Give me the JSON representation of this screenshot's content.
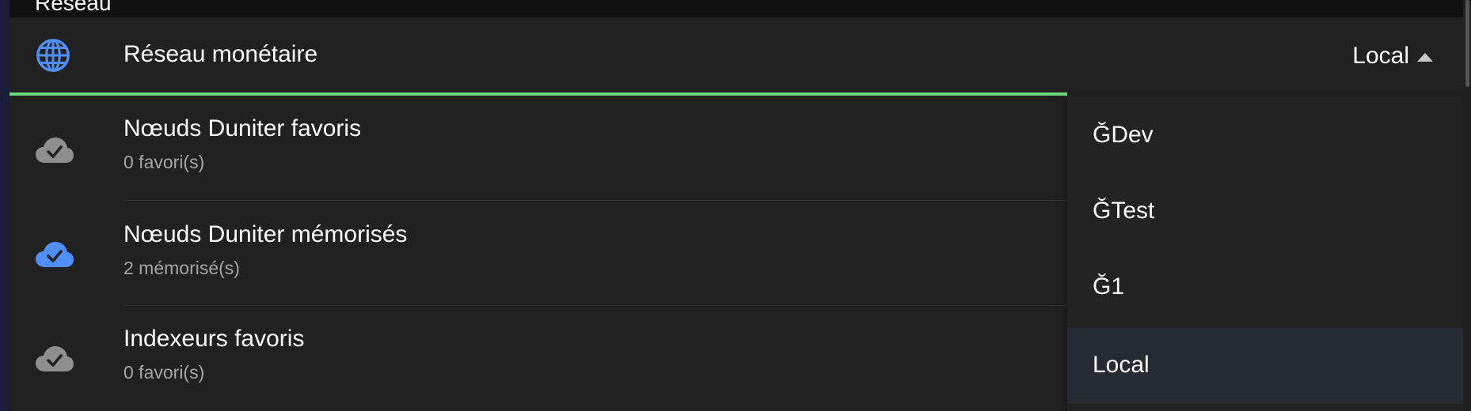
{
  "section": {
    "title": "Réseau"
  },
  "network": {
    "label": "Réseau monétaire",
    "selected": "Local",
    "icon": "globe-icon",
    "accent": "#6fd67c"
  },
  "items": [
    {
      "title": "Nœuds Duniter favoris",
      "subtitle": "0 favori(s)",
      "icon": "cloud-check-icon",
      "icon_color": "#8e8e8e"
    },
    {
      "title": "Nœuds Duniter mémorisés",
      "subtitle": "2 mémorisé(s)",
      "icon": "cloud-check-icon",
      "icon_color": "#4f8ff7"
    },
    {
      "title": "Indexeurs favoris",
      "subtitle": "0 favori(s)",
      "icon": "cloud-check-icon",
      "icon_color": "#8e8e8e"
    }
  ],
  "dropdown": {
    "options": [
      {
        "label": "ĞDev"
      },
      {
        "label": "ĞTest"
      },
      {
        "label": "Ğ1"
      },
      {
        "label": "Local",
        "selected": true
      }
    ]
  }
}
